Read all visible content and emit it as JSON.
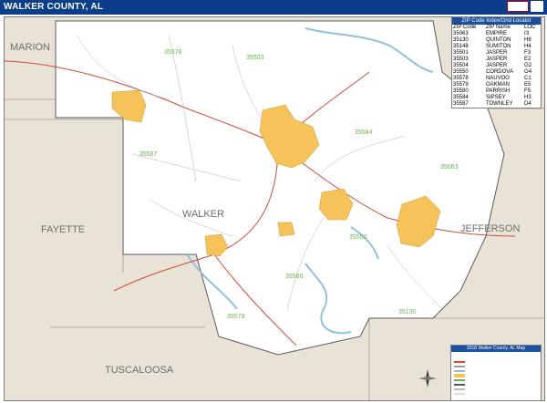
{
  "title": "WALKER COUNTY, AL",
  "zip_table": {
    "header": "ZIP Code Index/Grid Locator",
    "columns": [
      "ZIP Code",
      "ZIP Name",
      "LOC"
    ],
    "rows": [
      [
        "35063",
        "EMPIRE",
        "I3"
      ],
      [
        "35130",
        "QUINTON",
        "H6"
      ],
      [
        "35148",
        "SUMITON",
        "H4"
      ],
      [
        "35501",
        "JASPER",
        "F3"
      ],
      [
        "35503",
        "JASPER",
        "E2"
      ],
      [
        "35504",
        "JASPER",
        "G2"
      ],
      [
        "35550",
        "CORDOVA",
        "G4"
      ],
      [
        "35578",
        "NAUVOO",
        "C1"
      ],
      [
        "35579",
        "OAKMAN",
        "E5"
      ],
      [
        "35580",
        "PARRISH",
        "F5"
      ],
      [
        "35584",
        "SIPSEY",
        "H3"
      ],
      [
        "35587",
        "TOWNLEY",
        "D4"
      ]
    ]
  },
  "counties": {
    "marion": "MARION",
    "fayette": "FAYETTE",
    "walker": "WALKER",
    "jefferson": "JEFFERSON",
    "tuscaloosa": "TUSCALOOSA"
  },
  "zip_labels": {
    "z35578": "35578",
    "z35503": "35503",
    "z35584": "35584",
    "z35587": "35587",
    "z35063": "35063",
    "z35550": "35550",
    "z35580": "35580",
    "z35579": "35579",
    "z35130": "35130"
  },
  "legend": {
    "header": "2018 Walker County, AL Map"
  },
  "colors": {
    "title_bar": "#0a3d8a",
    "county_fill": "#ffffff",
    "surround_fill": "#e8e3d6",
    "urban": "#f5c35a",
    "water": "#8fc1de",
    "roads_major": "#d04a3a",
    "roads_minor": "#9a9a9a",
    "zip_label": "#6ab04c"
  }
}
